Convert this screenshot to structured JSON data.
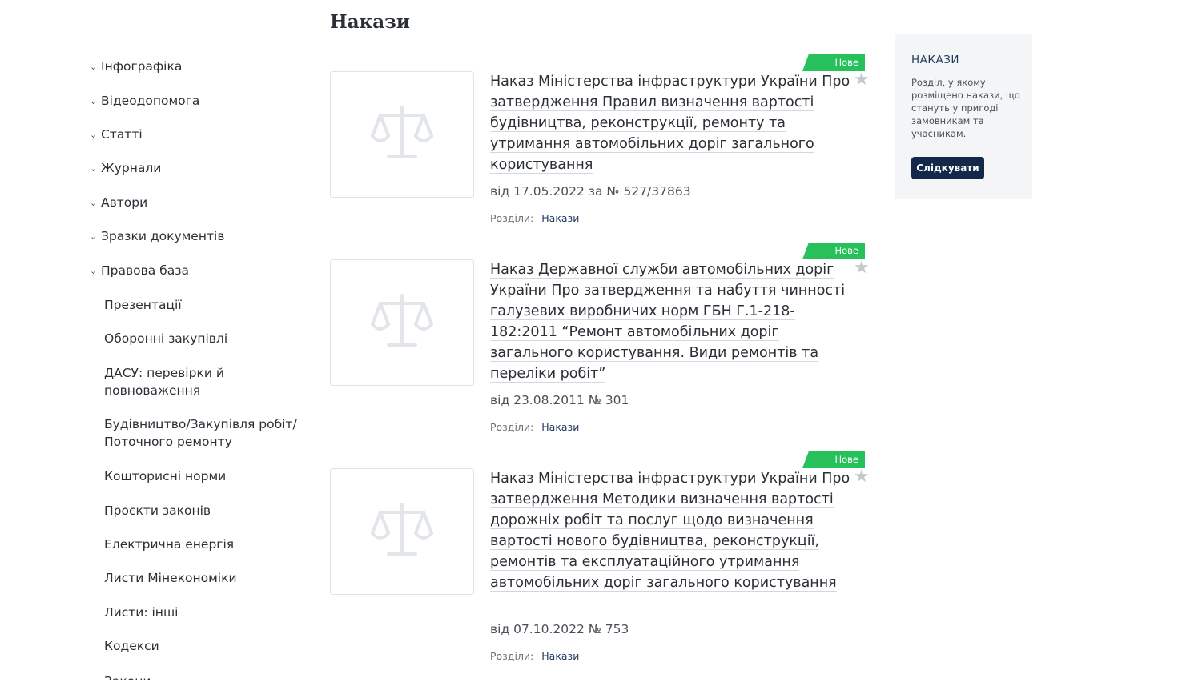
{
  "page": {
    "title": "Накази"
  },
  "sidebar": {
    "items": [
      {
        "label": "Інфографіка"
      },
      {
        "label": "Відеодопомога"
      },
      {
        "label": "Статті"
      },
      {
        "label": "Журнали"
      },
      {
        "label": "Автори"
      },
      {
        "label": "Зразки документів"
      },
      {
        "label": "Правова база"
      }
    ],
    "subitems": [
      {
        "label": "Презентації"
      },
      {
        "label": "Оборонні закупівлі"
      },
      {
        "label": "ДАСУ: перевірки й повноваження"
      },
      {
        "label": "Будівництво/Закупівля робіт/ Поточного ремонту"
      },
      {
        "label": "Кошторисні норми"
      },
      {
        "label": "Проєкти законів"
      },
      {
        "label": "Електрична енергія"
      },
      {
        "label": "Листи Мінекономіки"
      },
      {
        "label": "Листи: інші"
      },
      {
        "label": "Кодекси"
      },
      {
        "label": "Закони"
      }
    ]
  },
  "cards": [
    {
      "badge": "Нове",
      "title": "Наказ Міністерства інфраструктури України Про затвердження Правил визначення вартості будівництва, реконструкції, ремонту та утримання автомобільних доріг загального користування",
      "meta": "від 17.05.2022 за № 527/37863",
      "sections_label": "Розділи:",
      "section": "Накази"
    },
    {
      "badge": "Нове",
      "title": "Наказ Державної служби автомобільних доріг України Про затвердження та набуття чинності галузевих виробничих норм ГБН Г.1-218-182:2011 “Ремонт автомобільних доріг загального користування. Види ремонтів та переліки робіт”",
      "meta": "від 23.08.2011 № 301",
      "sections_label": "Розділи:",
      "section": "Накази"
    },
    {
      "badge": "Нове",
      "title": "Наказ Міністерства інфраструктури України Про затвердження Методики визначення вартості дорожніх робіт та послуг щодо визначення вартості нового будівництва, реконструкції, ремонтів та експлуатаційного утримання автомобільних доріг загального користування",
      "meta": "від 07.10.2022  № 753",
      "sections_label": "Розділи:",
      "section": "Накази"
    }
  ],
  "panel": {
    "title": "НАКАЗИ",
    "description": "Розділ, у якому розміщено накази, що стануть у пригоді замовникам та учасникам.",
    "button": "Слідкувати"
  },
  "colors": {
    "badge": "#27c15b",
    "button": "#14294a",
    "panel_bg": "#f3f5f7",
    "link": "#1f3a5f"
  }
}
